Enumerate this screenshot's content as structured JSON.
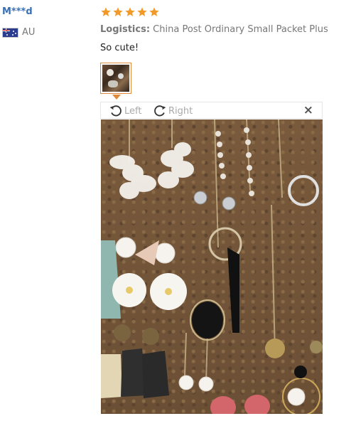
{
  "review": {
    "user": "M***d",
    "country": "AU",
    "rating": 5,
    "logistics_label": "Logistics:",
    "logistics_value": "China Post Ordinary Small Packet Plus",
    "text": "So cute!"
  },
  "viewer": {
    "rotate_left_label": "Left",
    "rotate_right_label": "Right",
    "close_label": "×"
  },
  "colors": {
    "username": "#3a6fb5",
    "star": "#f29a29",
    "thumb_border": "#e08a3c",
    "muted_text": "#777777"
  }
}
